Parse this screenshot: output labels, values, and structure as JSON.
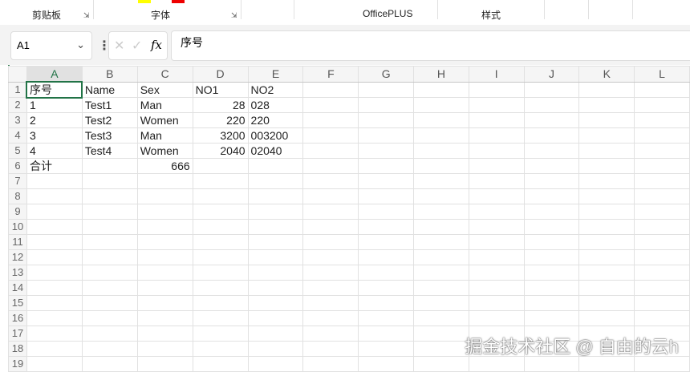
{
  "ribbon": {
    "groups": [
      "剪贴板",
      "字体",
      "OfficePLUS",
      "样式"
    ]
  },
  "formula_bar": {
    "name_box": "A1",
    "content": "序号",
    "fx": "fx"
  },
  "columns": [
    "A",
    "B",
    "C",
    "D",
    "E",
    "F",
    "G",
    "H",
    "I",
    "J",
    "K",
    "L"
  ],
  "rows": [
    [
      "序号",
      "Name",
      "Sex",
      "NO1",
      "NO2"
    ],
    [
      "1",
      "Test1",
      "Man",
      "28",
      "028"
    ],
    [
      "2",
      "Test2",
      "Women",
      "220",
      "220"
    ],
    [
      "3",
      "Test3",
      "Man",
      "3200",
      "003200"
    ],
    [
      "4",
      "Test4",
      "Women",
      "2040",
      "02040"
    ],
    [
      "合计",
      "",
      "666",
      "",
      ""
    ]
  ],
  "row_count": 19,
  "watermark": "掘金技术社区 @ 自由的云h"
}
